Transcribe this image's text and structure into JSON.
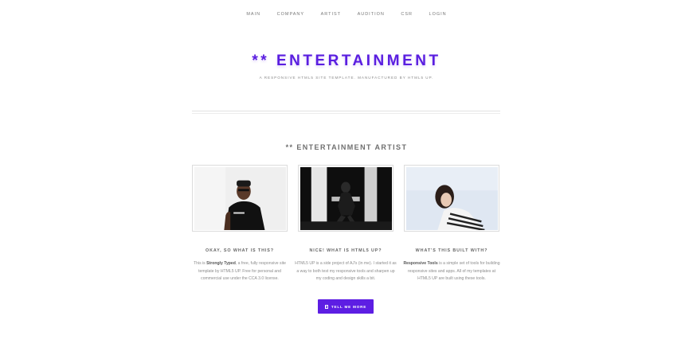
{
  "nav": {
    "items": [
      "MAIN",
      "COMPANY",
      "ARTIST",
      "AUDITION",
      "CSR",
      "LOGIN"
    ]
  },
  "hero": {
    "title": "** ENTERTAINMENT",
    "subtitle": "A RESPONSIVE HTML5 SITE TEMPLATE. MANUFACTURED BY HTML5 UP."
  },
  "section": {
    "title": "** ENTERTAINMENT ARTIST"
  },
  "cards": [
    {
      "heading": "OKAY, SO WHAT IS THIS?",
      "text_pre": "This is ",
      "text_bold": "Strongly Typed",
      "text_post": ", a free, fully responsive site template by HTML5 UP. Free for personal and commercial use under the CCA 3.0 license."
    },
    {
      "heading": "NICE! WHAT IS HTML5 UP?",
      "text_pre": "HTML5 UP is a side project of AJ's (in me). I started it as a way to both test my responsive tools and sharpen up my coding and design skills a bit.",
      "text_bold": "",
      "text_post": ""
    },
    {
      "heading": "WHAT'S THIS BUILT WITH?",
      "text_pre": "",
      "text_bold": "Responsive Tools",
      "text_post": " is a simple set of tools for building responsive sites and apps. All of my templates at HTML5 UP are built using these tools."
    }
  ],
  "cta": {
    "label": "TELL ME MORE",
    "icon": "document-icon"
  },
  "colors": {
    "accent": "#5d1ee3",
    "title": "#5a1ee0"
  }
}
